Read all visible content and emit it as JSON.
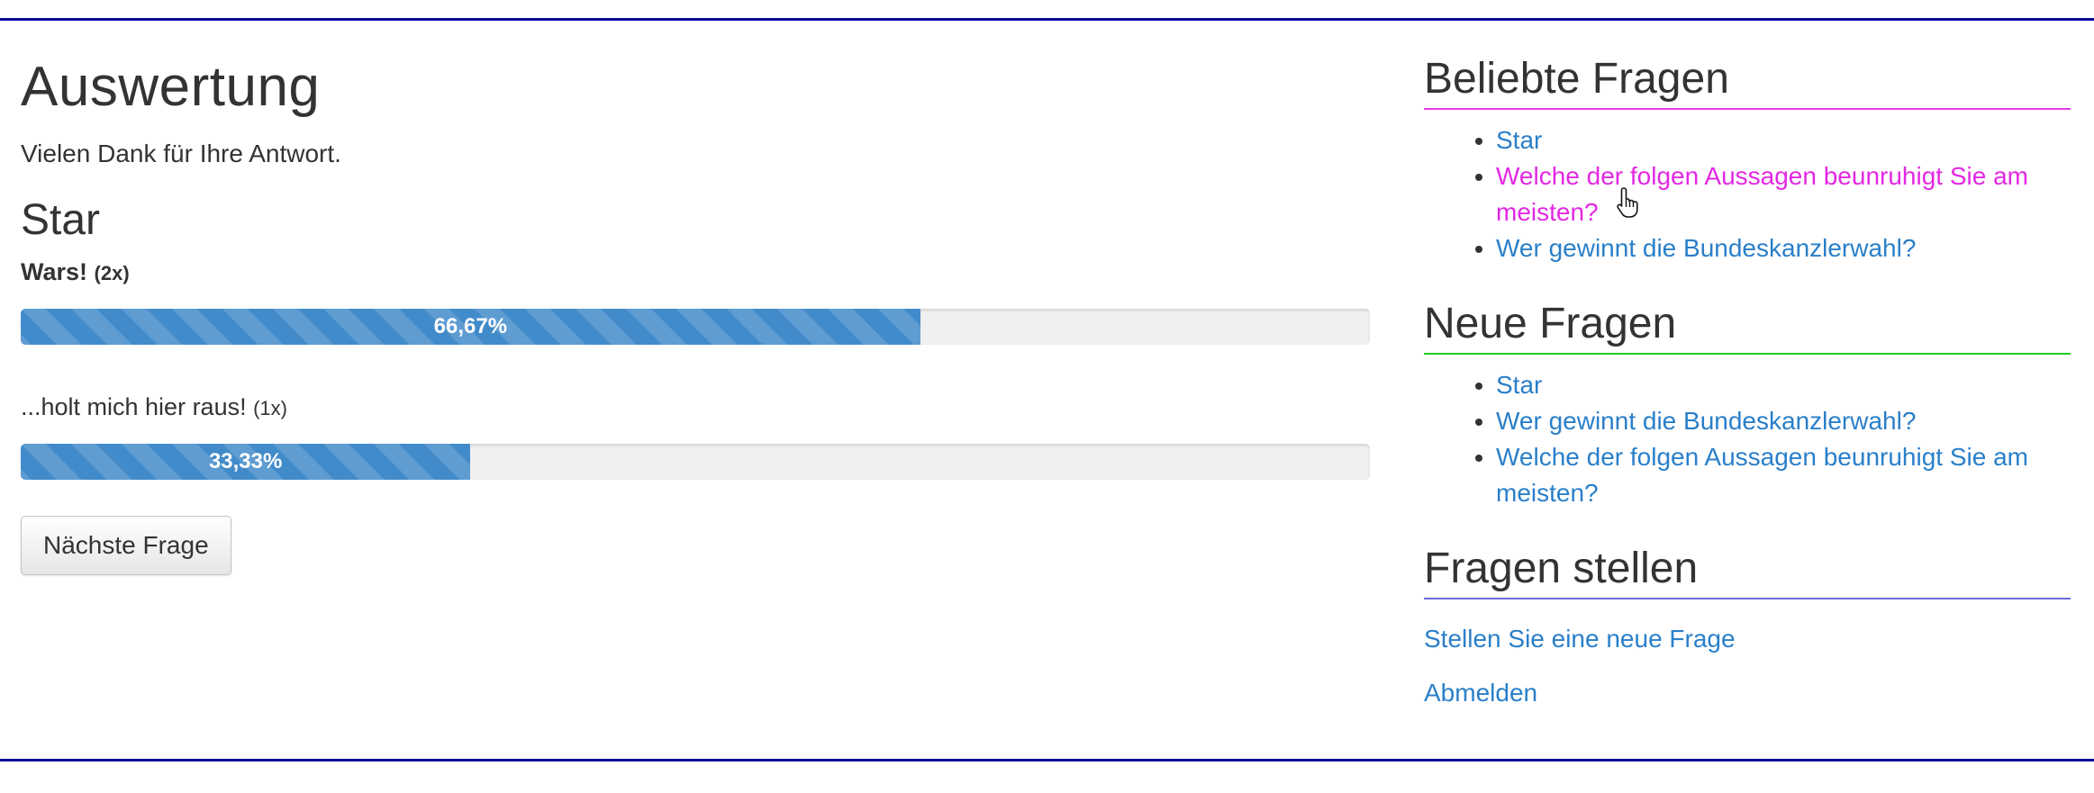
{
  "main": {
    "title": "Auswertung",
    "thanks": "Vielen Dank für Ihre Antwort.",
    "question": "Star",
    "answers": [
      {
        "label": "Wars!",
        "count": "(2x)",
        "percent_label": "66,67%",
        "percent": 66.67,
        "bold": true
      },
      {
        "label": "...holt mich hier raus!",
        "count": "(1x)",
        "percent_label": "33,33%",
        "percent": 33.33,
        "bold": false
      }
    ],
    "next_button": "Nächste Frage"
  },
  "sidebar": {
    "popular": {
      "heading": "Beliebte Fragen",
      "items": [
        "Star",
        "Welche der folgen Aussagen beunruhigt Sie am meisten?",
        "Wer gewinnt die Bundeskanzlerwahl?"
      ]
    },
    "new": {
      "heading": "Neue Fragen",
      "items": [
        "Star",
        "Wer gewinnt die Bundeskanzlerwahl?",
        "Welche der folgen Aussagen beunruhigt Sie am meisten?"
      ]
    },
    "ask": {
      "heading": "Fragen stellen",
      "new_question_link": "Stellen Sie eine neue Frage",
      "logout_link": "Abmelden"
    }
  },
  "colors": {
    "link": "#2a7fc9",
    "link_hover": "#e328e3",
    "progress": "#428bca",
    "rule": "#0a0a9a",
    "popular_underline": "#e83ae8",
    "new_underline": "#22cc22",
    "ask_underline": "#6b6bdc"
  },
  "icons": {
    "cursor": "hand-pointer-icon"
  }
}
